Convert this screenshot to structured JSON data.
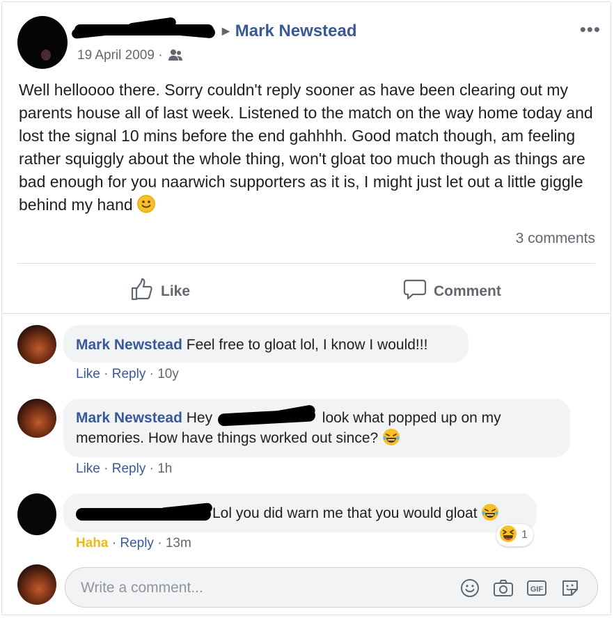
{
  "post": {
    "target_name": "Mark Newstead",
    "date": "19 April 2009",
    "audience_separator": "·",
    "more_label": "•••",
    "text": "Well helloooo there. Sorry couldn't reply sooner as have been clearing out my parents house all of last week. Listened to the match on the way home today and lost the signal 10 mins before the end gahhhh. Good match though, am feeling rather squiggly about the whole thing, won't gloat too much though as things are bad enough for you naarwich supporters as it is, I might just let out a little giggle behind my hand",
    "comments_count": "3 comments"
  },
  "actions": {
    "like_label": "Like",
    "comment_label": "Comment"
  },
  "comments": [
    {
      "author": "Mark Newstead",
      "text": "Feel free to gloat lol, I know I would!!!",
      "like": "Like",
      "reply": "Reply",
      "time": "10y"
    },
    {
      "author": "Mark Newstead",
      "text_before": "Hey",
      "text_after": "look what popped up on my",
      "text_line2": "memories. How have things worked out since?",
      "like": "Like",
      "reply": "Reply",
      "time": "1h"
    },
    {
      "text": "Lol you did warn me that you would gloat",
      "reaction": "Haha",
      "reply": "Reply",
      "time": "13m",
      "reaction_count": "1"
    }
  ],
  "composer": {
    "placeholder": "Write a comment..."
  },
  "colors": {
    "link": "#385898",
    "haha": "#f0ba15",
    "secondary": "#606770"
  }
}
